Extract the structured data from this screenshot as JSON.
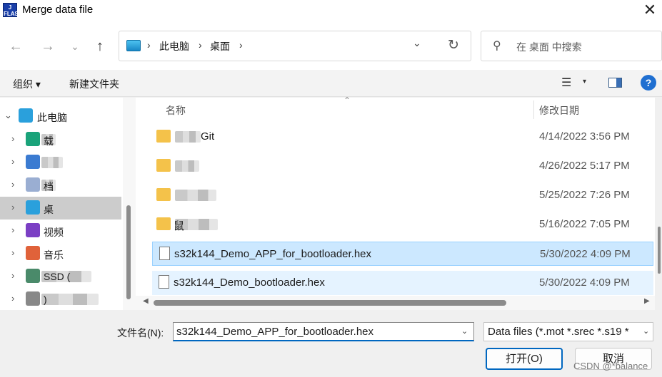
{
  "window": {
    "title": "Merge data file",
    "app_icon_text": "J\nFLASH",
    "close_symbol": "✕"
  },
  "nav": {
    "back": "←",
    "forward": "→",
    "recent": "⌄",
    "up": "↑"
  },
  "address": {
    "crumbs": [
      "此电脑",
      "桌面"
    ],
    "separator": "›",
    "dropdown": "⌄",
    "refresh": "↻"
  },
  "search": {
    "icon": "search-icon",
    "placeholder": "在 桌面 中搜索"
  },
  "toolbar": {
    "organize": "组织 ▾",
    "new_folder": "新建文件夹",
    "view_icon": "☰",
    "view_caret": "▾",
    "help": "?"
  },
  "tree": {
    "items": [
      {
        "label": "此电脑",
        "chev": "⌄",
        "icon": "pc-icon",
        "color": "#2aa0dc"
      },
      {
        "label": "载",
        "chev": "›",
        "icon": "download-icon",
        "color": "#1aa37a"
      },
      {
        "label": "",
        "chev": "›",
        "icon": "document-blur-icon",
        "color": "#3b7bd1"
      },
      {
        "label": "档",
        "chev": "›",
        "icon": "document-icon",
        "color": "#9aaed2"
      },
      {
        "label": "桌",
        "chev": "›",
        "icon": "desktop-icon",
        "color": "#2aa0dc"
      },
      {
        "label": "视频",
        "chev": "›",
        "icon": "video-icon",
        "color": "#7b3fc4"
      },
      {
        "label": "音乐",
        "chev": "›",
        "icon": "music-icon",
        "color": "#e0623a"
      },
      {
        "label": "SSD (",
        "chev": "›",
        "icon": "drive-icon",
        "color": "#4a8a6a"
      },
      {
        "label": ")",
        "chev": "›",
        "icon": "drive-icon",
        "color": "#888888"
      }
    ]
  },
  "files": {
    "columns": {
      "name": "名称",
      "date": "修改日期",
      "sort": "⌃"
    },
    "rows": [
      {
        "name": "Git",
        "date": "4/14/2022 3:56 PM",
        "type": "folder"
      },
      {
        "name": "",
        "date": "4/26/2022 5:17 PM",
        "type": "folder"
      },
      {
        "name": "",
        "date": "5/25/2022 7:26 PM",
        "type": "folder"
      },
      {
        "name": "鼠",
        "date": "5/16/2022 7:05 PM",
        "type": "folder"
      },
      {
        "name": "s32k144_Demo_APP_for_bootloader.hex",
        "date": "5/30/2022 4:09 PM",
        "type": "file"
      },
      {
        "name": "s32k144_Demo_bootloader.hex",
        "date": "5/30/2022 4:09 PM",
        "type": "file"
      }
    ]
  },
  "bottom": {
    "filename_label": "文件名(N):",
    "filename_value": "s32k144_Demo_APP_for_bootloader.hex",
    "filter": "Data files (*.mot *.srec *.s19 *",
    "open": "打开(O)",
    "cancel": "取消",
    "watermark": "CSDN @*balance"
  }
}
